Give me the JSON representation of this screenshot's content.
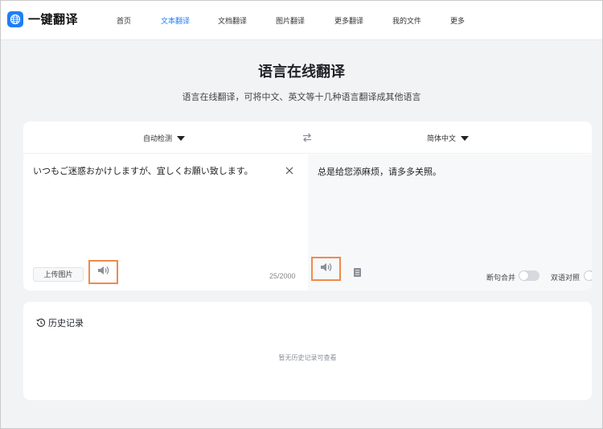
{
  "brand": {
    "name": "一键翻译",
    "color": "#1f7ef6"
  },
  "nav": [
    {
      "label": "首页"
    },
    {
      "label": "文本翻译",
      "active": true
    },
    {
      "label": "文档翻译"
    },
    {
      "label": "图片翻译"
    },
    {
      "label": "更多翻译"
    },
    {
      "label": "我的文件"
    },
    {
      "label": "更多"
    }
  ],
  "hero": {
    "title": "语言在线翻译",
    "subtitle": "语言在线翻译，可将中文、英文等十几种语言翻译成其他语言"
  },
  "translator": {
    "source_lang": "自动检测",
    "target_lang": "简体中文",
    "source_text": "いつもご迷惑おかけしますが、宜しくお願い致します。",
    "target_text": "总是给您添麻烦，请多多关照。",
    "upload_label": "上传图片",
    "char_count": "25/2000",
    "toggle_merge_label": "断句合并",
    "toggle_bilingual_label": "双语对照",
    "toggle_merge_on": false,
    "toggle_bilingual_on": false,
    "highlight_color": "#f08a4b"
  },
  "history": {
    "title": "历史记录",
    "empty_text": "暂无历史记录可查看"
  },
  "icons": {
    "logo": "globe-icon",
    "swap": "swap-arrows-icon",
    "clear": "close-icon",
    "speaker": "speaker-icon",
    "copy": "copy-icon",
    "history": "history-clock-icon"
  }
}
